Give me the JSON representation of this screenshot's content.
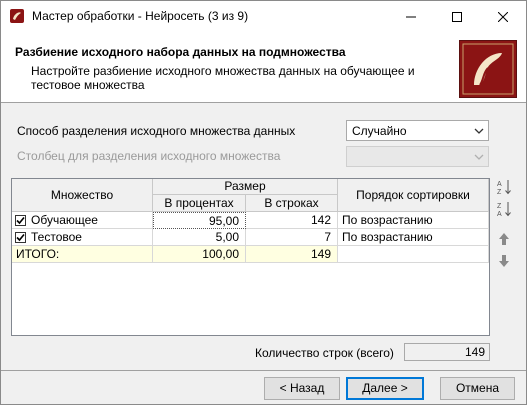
{
  "window": {
    "title": "Мастер обработки - Нейросеть (3 из 9)"
  },
  "header": {
    "title": "Разбиение исходного набора данных на подмножества",
    "description": "Настройте разбиение исходного множества данных на обучающее и тестовое множества"
  },
  "form": {
    "split_method_label": "Способ разделения исходного множества данных",
    "split_method_value": "Случайно",
    "split_column_label": "Столбец для разделения исходного множества",
    "split_column_value": ""
  },
  "grid": {
    "col_set": "Множество",
    "col_size": "Размер",
    "col_percent": "В процентах",
    "col_rows": "В строках",
    "col_sort": "Порядок сортировки",
    "rows": [
      {
        "name": "Обучающее",
        "checked": true,
        "percent": "95,00",
        "rows": "142",
        "sort": "По возрастанию"
      },
      {
        "name": "Тестовое",
        "checked": true,
        "percent": "5,00",
        "rows": "7",
        "sort": "По возрастанию"
      }
    ],
    "total": {
      "name": "ИТОГО:",
      "percent": "100,00",
      "rows": "149",
      "sort": ""
    }
  },
  "footer": {
    "row_count_label": "Количество строк (всего)",
    "row_count_value": "149",
    "back_label": "< Назад",
    "next_label": "Далее >",
    "cancel_label": "Отмена"
  },
  "colors": {
    "accent": "#0078d7",
    "logo_bg": "#8b1414",
    "total_row_bg": "#ffffe1"
  }
}
